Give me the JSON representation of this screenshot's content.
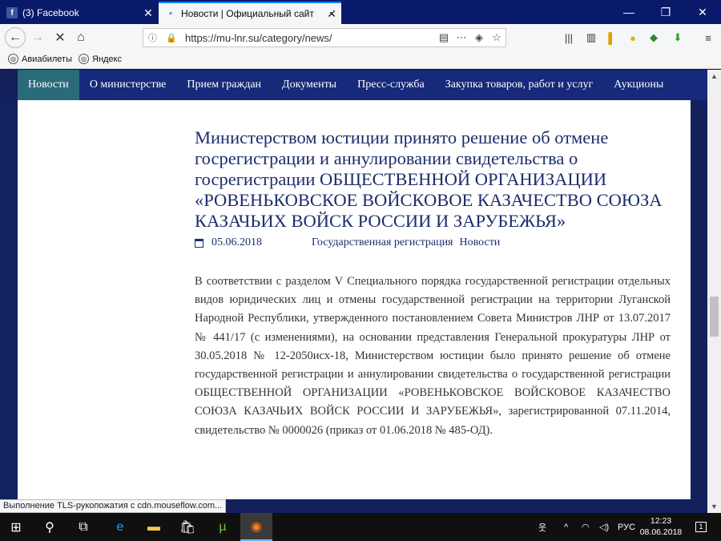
{
  "browser": {
    "tabs": [
      {
        "label": "(3) Facebook"
      },
      {
        "label": "Новости | Официальный сайт"
      }
    ],
    "new_tab_symbol": "+",
    "url": "https://mu-lnr.su/category/news/",
    "bookmarks": [
      "Авиабилеты",
      "Яндекс"
    ],
    "status_text": "Выполнение TLS-рукопожатия с cdn.mouseflow.com..."
  },
  "site": {
    "menu": [
      "Новости",
      "О министерстве",
      "Прием граждан",
      "Документы",
      "Пресс-служба",
      "Закупка товаров, работ и услуг",
      "Аукционы"
    ],
    "active_menu": "Новости"
  },
  "article": {
    "title": "Министерством юстиции принято решение об отмене госрегистрации и аннулировании свидетельства о госрегистрации ОБЩЕСТВЕННОЙ ОРГАНИЗАЦИИ «РОВЕНЬКОВСКОЕ ВОЙСКОВОЕ КАЗАЧЕСТВО СОЮЗА КАЗАЧЬИХ ВОЙСК РОССИИ И ЗАРУБЕЖЬЯ»",
    "date": "05.06.2018",
    "categories": [
      "Государственная регистрация",
      "Новости"
    ],
    "body": "В соответствии с разделом V Специального порядка государственной регистрации отдельных видов юридических лиц и отмены государственной регистрации на территории Луганской Народной Республики, утвержденного постановлением Совета Министров ЛНР от 13.07.2017 № 441/17 (с изменениями), на основании представления Генеральной прокуратуры ЛНР от 30.05.2018 № 12-2050исх-18, Министерством юстиции было принято решение об отмене государственной регистрации и аннулировании свидетельства о государственной регистрации ОБЩЕСТВЕННОЙ ОРГАНИЗАЦИИ «РОВЕНЬКОВСКОЕ ВОЙСКОВОЕ КАЗАЧЕСТВО СОЮЗА КАЗАЧЬИХ ВОЙСК РОССИИ И ЗАРУБЕЖЬЯ», зарегистрированной 07.11.2014, свидетельство № 0000026 (приказ от 01.06.2018 № 485-ОД)."
  },
  "taskbar": {
    "language": "РУС",
    "time": "12:23",
    "date": "08.06.2018",
    "notification_count": "1"
  },
  "colors": {
    "tabbar": "#0a1a6b",
    "site_menu": "#16297a",
    "active_menu": "#2a6b7a",
    "title_text": "#1d2d6b"
  }
}
